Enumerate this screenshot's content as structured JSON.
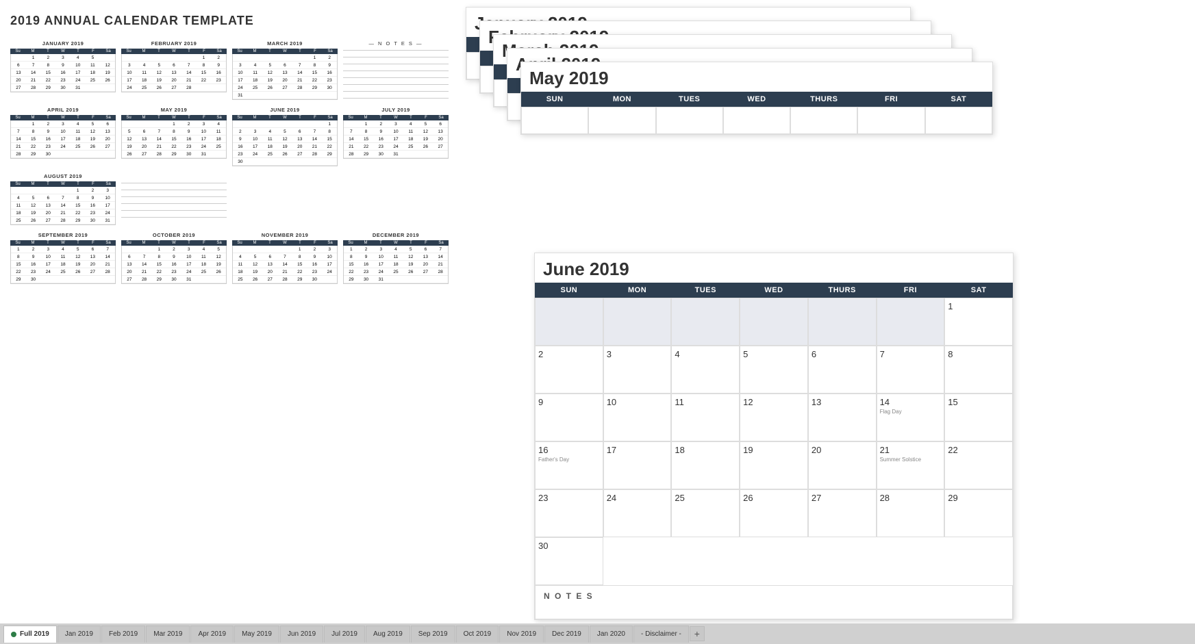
{
  "title": "2019 ANNUAL CALENDAR TEMPLATE",
  "miniCalendars": [
    {
      "name": "JANUARY 2019",
      "days": [
        "",
        "1",
        "2",
        "3",
        "4",
        "5",
        "",
        "6",
        "7",
        "8",
        "9",
        "10",
        "11",
        "12",
        "13",
        "14",
        "15",
        "16",
        "17",
        "18",
        "19",
        "20",
        "21",
        "22",
        "23",
        "24",
        "25",
        "26",
        "27",
        "28",
        "29",
        "30",
        "31"
      ]
    },
    {
      "name": "FEBRUARY 2019",
      "days": [
        "",
        "",
        "",
        "",
        "",
        "1",
        "2",
        "3",
        "4",
        "5",
        "6",
        "7",
        "8",
        "9",
        "10",
        "11",
        "12",
        "13",
        "14",
        "15",
        "16",
        "17",
        "18",
        "19",
        "20",
        "21",
        "22",
        "23",
        "24",
        "25",
        "26",
        "27",
        "28"
      ]
    },
    {
      "name": "MARCH 2019",
      "days": [
        "",
        "",
        "",
        "",
        "",
        "1",
        "2",
        "3",
        "4",
        "5",
        "6",
        "7",
        "8",
        "9",
        "10",
        "11",
        "12",
        "13",
        "14",
        "15",
        "16",
        "17",
        "18",
        "19",
        "20",
        "21",
        "22",
        "23",
        "24",
        "25",
        "26",
        "27",
        "28",
        "29",
        "30",
        "31"
      ]
    },
    {
      "name": "APRIL 2019",
      "days": [
        "",
        "1",
        "2",
        "3",
        "4",
        "5",
        "6",
        "7",
        "8",
        "9",
        "10",
        "11",
        "12",
        "13",
        "14",
        "15",
        "16",
        "17",
        "18",
        "19",
        "20",
        "21",
        "22",
        "23",
        "24",
        "25",
        "26",
        "27",
        "28",
        "29",
        "30"
      ]
    },
    {
      "name": "MAY 2019",
      "days": [
        "",
        "",
        "",
        "1",
        "2",
        "3",
        "4",
        "5",
        "6",
        "7",
        "8",
        "9",
        "10",
        "11",
        "12",
        "13",
        "14",
        "15",
        "16",
        "17",
        "18",
        "19",
        "20",
        "21",
        "22",
        "23",
        "24",
        "25",
        "26",
        "27",
        "28",
        "29",
        "30",
        "31"
      ]
    },
    {
      "name": "JUNE 2019",
      "days": [
        "",
        "",
        "",
        "",
        "",
        "",
        "1",
        "2",
        "3",
        "4",
        "5",
        "6",
        "7",
        "8",
        "9",
        "10",
        "11",
        "12",
        "13",
        "14",
        "15",
        "16",
        "17",
        "18",
        "19",
        "20",
        "21",
        "22",
        "23",
        "24",
        "25",
        "26",
        "27",
        "28",
        "29",
        "30"
      ]
    },
    {
      "name": "JULY 2019",
      "days": [
        "",
        "1",
        "2",
        "3",
        "4",
        "5",
        "6",
        "7",
        "8",
        "9",
        "10",
        "11",
        "12",
        "13",
        "14",
        "15",
        "16",
        "17",
        "18",
        "19",
        "20",
        "21",
        "22",
        "23",
        "24",
        "25",
        "26",
        "27",
        "28",
        "29",
        "30",
        "31"
      ]
    },
    {
      "name": "AUGUST 2019",
      "days": [
        "",
        "",
        "",
        "",
        "1",
        "2",
        "3",
        "4",
        "5",
        "6",
        "7",
        "8",
        "9",
        "10",
        "11",
        "12",
        "13",
        "14",
        "15",
        "16",
        "17",
        "18",
        "19",
        "20",
        "21",
        "22",
        "23",
        "24",
        "25",
        "26",
        "27",
        "28",
        "29",
        "30",
        "31"
      ]
    },
    {
      "name": "SEPTEMBER 2019",
      "days": [
        "1",
        "2",
        "3",
        "4",
        "5",
        "6",
        "7",
        "8",
        "9",
        "10",
        "11",
        "12",
        "13",
        "14",
        "15",
        "16",
        "17",
        "18",
        "19",
        "20",
        "21",
        "22",
        "23",
        "24",
        "25",
        "26",
        "27",
        "28",
        "29",
        "30"
      ]
    },
    {
      "name": "OCTOBER 2019",
      "days": [
        "",
        "",
        "1",
        "2",
        "3",
        "4",
        "5",
        "6",
        "7",
        "8",
        "9",
        "10",
        "11",
        "12",
        "13",
        "14",
        "15",
        "16",
        "17",
        "18",
        "19",
        "20",
        "21",
        "22",
        "23",
        "24",
        "25",
        "26",
        "27",
        "28",
        "29",
        "30",
        "31"
      ]
    },
    {
      "name": "NOVEMBER 2019",
      "days": [
        "",
        "",
        "",
        "",
        "1",
        "2",
        "3",
        "4",
        "5",
        "6",
        "7",
        "8",
        "9",
        "10",
        "11",
        "12",
        "13",
        "14",
        "15",
        "16",
        "17",
        "18",
        "19",
        "20",
        "21",
        "22",
        "23",
        "24",
        "25",
        "26",
        "27",
        "28",
        "29",
        "30"
      ]
    },
    {
      "name": "DECEMBER 2019",
      "days": [
        "1",
        "2",
        "3",
        "4",
        "5",
        "6",
        "7",
        "8",
        "9",
        "10",
        "11",
        "12",
        "13",
        "14",
        "15",
        "16",
        "17",
        "18",
        "19",
        "20",
        "21",
        "22",
        "23",
        "24",
        "25",
        "26",
        "27",
        "28",
        "29",
        "30",
        "31"
      ]
    }
  ],
  "tabs": [
    {
      "label": "Full 2019",
      "active": true
    },
    {
      "label": "Jan 2019",
      "active": false
    },
    {
      "label": "Feb 2019",
      "active": false
    },
    {
      "label": "Mar 2019",
      "active": false
    },
    {
      "label": "Apr 2019",
      "active": false
    },
    {
      "label": "May 2019",
      "active": false
    },
    {
      "label": "Jun 2019",
      "active": false
    },
    {
      "label": "Jul 2019",
      "active": false
    },
    {
      "label": "Aug 2019",
      "active": false
    },
    {
      "label": "Sep 2019",
      "active": false
    },
    {
      "label": "Oct 2019",
      "active": false
    },
    {
      "label": "Nov 2019",
      "active": false
    },
    {
      "label": "Dec 2019",
      "active": false
    },
    {
      "label": "Jan 2020",
      "active": false
    },
    {
      "label": "- Disclaimer -",
      "active": false
    }
  ],
  "juneCal": {
    "title": "June 2019",
    "weekDays": [
      "SUN",
      "MON",
      "TUES",
      "WED",
      "THURS",
      "FRI",
      "SAT"
    ],
    "weeks": [
      [
        "",
        "",
        "",
        "",
        "",
        "",
        "1"
      ],
      [
        "2",
        "3",
        "4",
        "5",
        "6",
        "7",
        "8"
      ],
      [
        "9",
        "10",
        "11",
        "12",
        "13",
        "14",
        "15"
      ],
      [
        "16",
        "17",
        "18",
        "19",
        "20",
        "21",
        "22"
      ],
      [
        "23",
        "24",
        "25",
        "26",
        "27",
        "28",
        "29"
      ],
      [
        "30",
        "",
        "",
        "",
        "",
        "",
        ""
      ]
    ],
    "holidays": {
      "14": "Flag Day",
      "16": "Father's Day",
      "21": "Summer Solstice"
    }
  },
  "stackedMonths": [
    {
      "title": "January 2019"
    },
    {
      "title": "February 2019"
    },
    {
      "title": "March 2019"
    },
    {
      "title": "April 2019"
    },
    {
      "title": "May 2019"
    }
  ],
  "notes_label": "— N O T E S —"
}
